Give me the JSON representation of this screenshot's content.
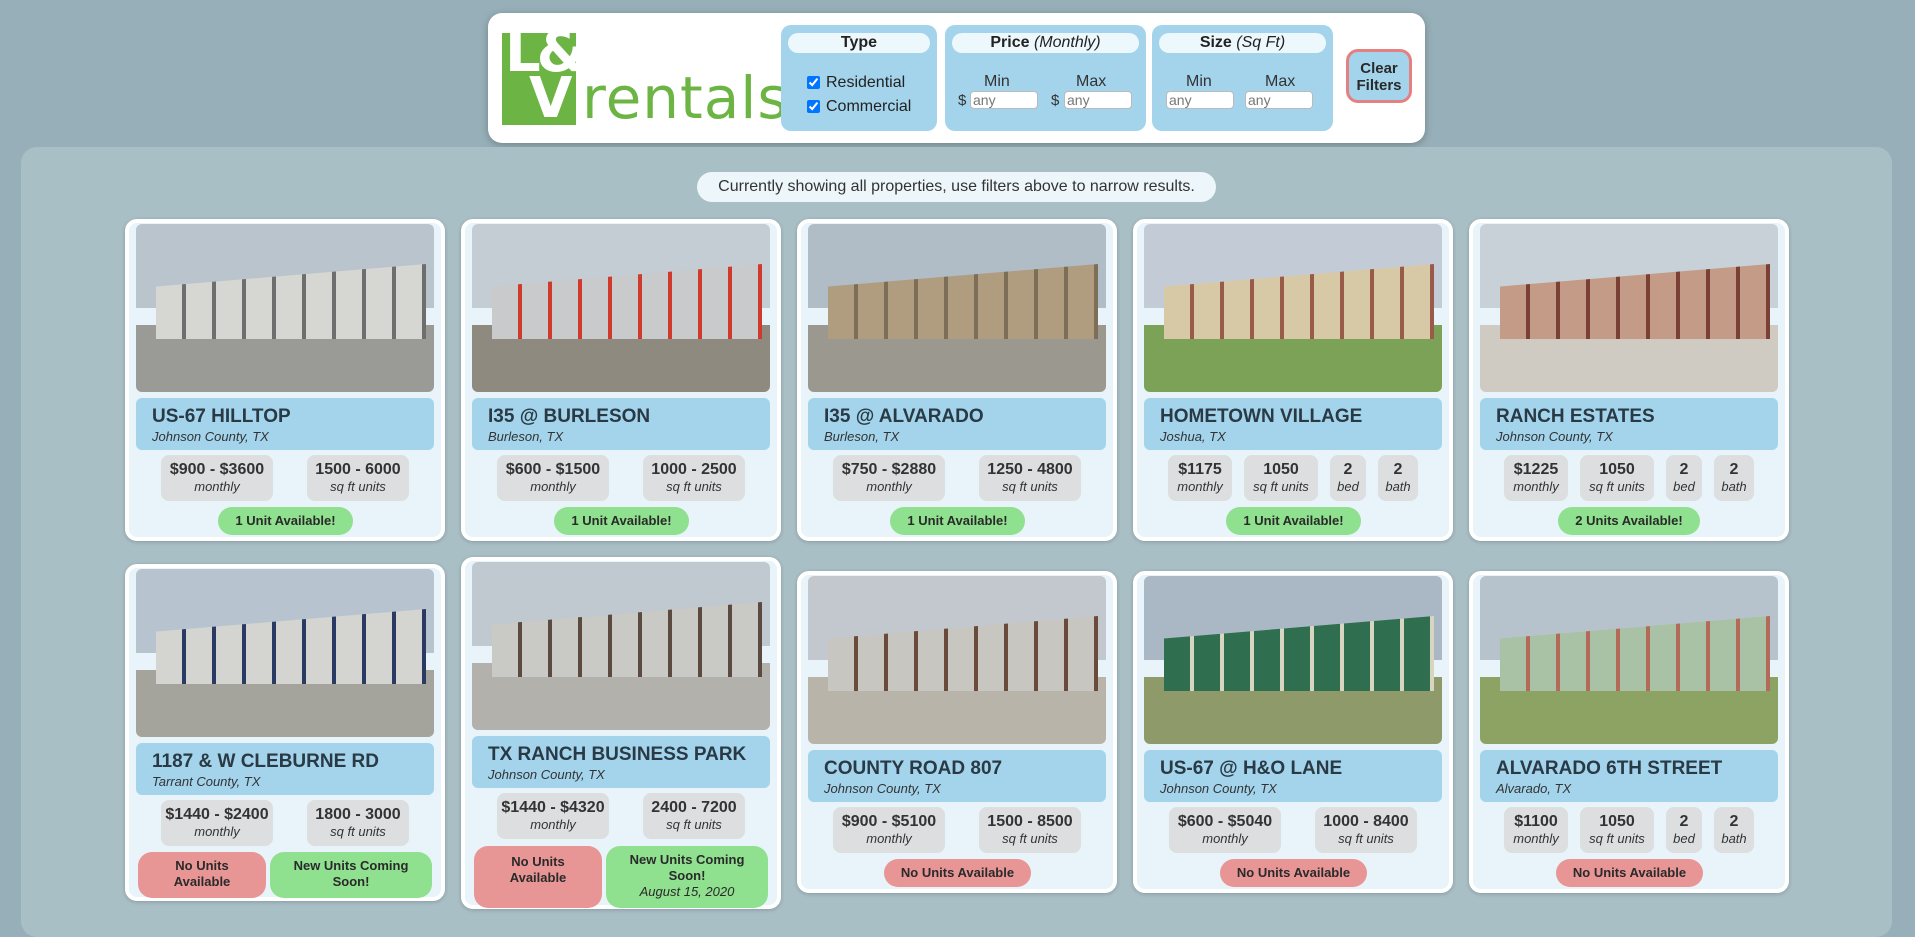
{
  "logo": {
    "letters_top": "L&",
    "letters_bottom": "V",
    "word": "rentals",
    "brand_color": "#6cb544"
  },
  "filters": {
    "type": {
      "title": "Type",
      "options": [
        {
          "label": "Residential",
          "checked": true
        },
        {
          "label": "Commercial",
          "checked": true
        }
      ]
    },
    "price": {
      "title": "Price",
      "title_note": "(Monthly)",
      "min_label": "Min",
      "max_label": "Max",
      "currency": "$",
      "min_placeholder": "any",
      "max_placeholder": "any"
    },
    "size": {
      "title": "Size",
      "title_note": "(Sq Ft)",
      "min_label": "Min",
      "max_label": "Max",
      "min_placeholder": "any",
      "max_placeholder": "any"
    },
    "clear_label_1": "Clear",
    "clear_label_2": "Filters"
  },
  "status_text": "Currently showing all properties, use filters above to narrow results.",
  "colors": {
    "available": "#8fe08f",
    "unavailable": "#e89595",
    "title_bar": "#a3d4ec"
  },
  "properties": [
    {
      "name": "US-67 HILLTOP",
      "location": "Johnson County, TX",
      "price": "$900 - $3600",
      "price_unit": "monthly",
      "size": "1500 - 6000",
      "size_unit": "sq ft units",
      "badges": [
        {
          "text": "1 Unit Available!",
          "kind": "green"
        }
      ]
    },
    {
      "name": "I35 @ BURLESON",
      "location": "Burleson, TX",
      "price": "$600 - $1500",
      "price_unit": "monthly",
      "size": "1000 - 2500",
      "size_unit": "sq ft units",
      "badges": [
        {
          "text": "1 Unit Available!",
          "kind": "green"
        }
      ]
    },
    {
      "name": "I35 @ ALVARADO",
      "location": "Burleson, TX",
      "price": "$750 - $2880",
      "price_unit": "monthly",
      "size": "1250 - 4800",
      "size_unit": "sq ft units",
      "badges": [
        {
          "text": "1 Unit Available!",
          "kind": "green"
        }
      ]
    },
    {
      "name": "HOMETOWN VILLAGE",
      "location": "Joshua, TX",
      "price": "$1175",
      "price_unit": "monthly",
      "size": "1050",
      "size_unit": "sq ft units",
      "bed": "2",
      "bed_unit": "bed",
      "bath": "2",
      "bath_unit": "bath",
      "badges": [
        {
          "text": "1 Unit Available!",
          "kind": "green"
        }
      ]
    },
    {
      "name": "RANCH ESTATES",
      "location": "Johnson County, TX",
      "price": "$1225",
      "price_unit": "monthly",
      "size": "1050",
      "size_unit": "sq ft units",
      "bed": "2",
      "bed_unit": "bed",
      "bath": "2",
      "bath_unit": "bath",
      "badges": [
        {
          "text": "2 Units Available!",
          "kind": "green"
        }
      ]
    },
    {
      "name": "1187 & W CLEBURNE RD",
      "location": "Tarrant County, TX",
      "price": "$1440 - $2400",
      "price_unit": "monthly",
      "size": "1800 - 3000",
      "size_unit": "sq ft units",
      "badges": [
        {
          "text": "No Units Available",
          "kind": "red"
        },
        {
          "text": "New Units Coming Soon!",
          "kind": "green"
        }
      ]
    },
    {
      "name": "TX RANCH BUSINESS PARK",
      "location": "Johnson County, TX",
      "price": "$1440 - $4320",
      "price_unit": "monthly",
      "size": "2400 - 7200",
      "size_unit": "sq ft units",
      "badges": [
        {
          "text": "No Units Available",
          "kind": "red"
        },
        {
          "text": "New Units Coming Soon!",
          "kind": "green",
          "date": "August 15, 2020"
        }
      ]
    },
    {
      "name": "COUNTY ROAD 807",
      "location": "Johnson County, TX",
      "price": "$900 - $5100",
      "price_unit": "monthly",
      "size": "1500 - 8500",
      "size_unit": "sq ft units",
      "badges": [
        {
          "text": "No Units Available",
          "kind": "red"
        }
      ]
    },
    {
      "name": "US-67 @ H&O LANE",
      "location": "Johnson County, TX",
      "price": "$600 - $5040",
      "price_unit": "monthly",
      "size": "1000 - 8400",
      "size_unit": "sq ft units",
      "badges": [
        {
          "text": "No Units Available",
          "kind": "red"
        }
      ]
    },
    {
      "name": "ALVARADO 6TH STREET",
      "location": "Alvarado, TX",
      "price": "$1100",
      "price_unit": "monthly",
      "size": "1050",
      "size_unit": "sq ft units",
      "bed": "2",
      "bed_unit": "bed",
      "bath": "2",
      "bath_unit": "bath",
      "badges": [
        {
          "text": "No Units Available",
          "kind": "red"
        }
      ]
    }
  ]
}
